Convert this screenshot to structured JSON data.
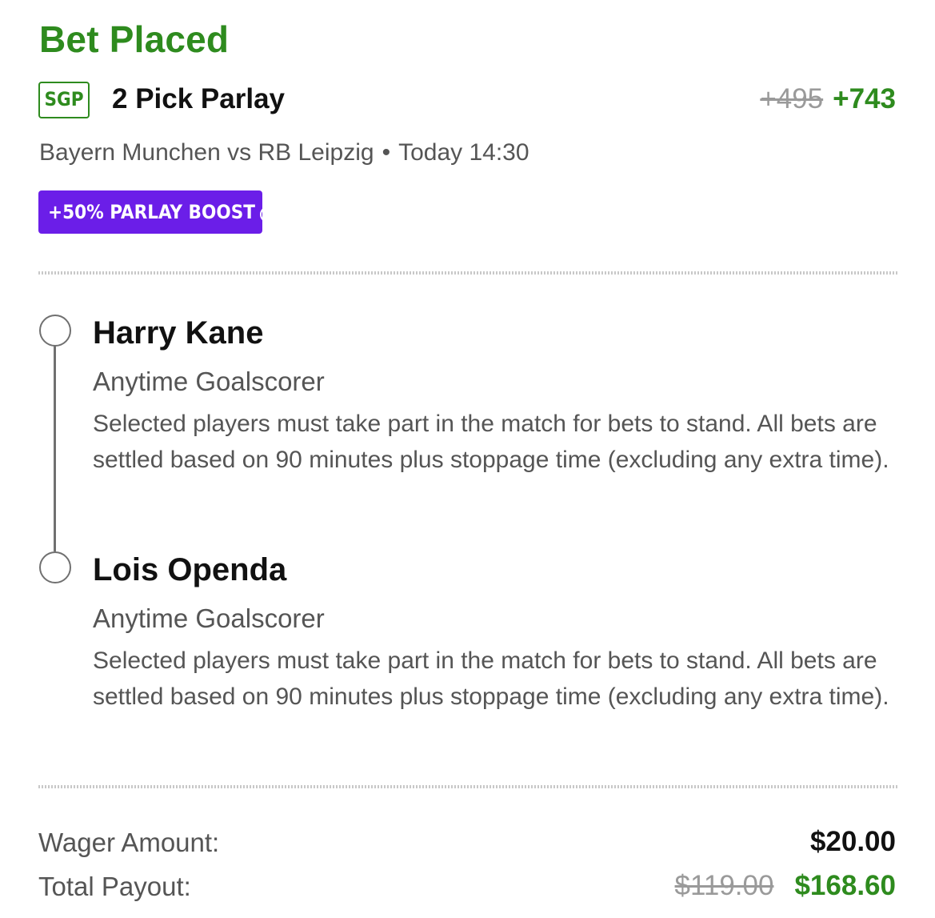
{
  "status": {
    "title": "Bet Placed"
  },
  "bet": {
    "badge": "SGP",
    "title": "2 Pick Parlay",
    "odds_original": "+495",
    "odds_boosted": "+743",
    "match": "Bayern Munchen vs RB Leipzig",
    "separator": "•",
    "time": "Today 14:30",
    "boost_label": "+50% PARLAY BOOST",
    "boost_info_icon": "i"
  },
  "legs": [
    {
      "player": "Harry Kane",
      "market": "Anytime Goalscorer",
      "rules": "Selected players must take part in the match for bets to stand. All bets are settled based on 90 minutes plus stoppage time (excluding any extra time)."
    },
    {
      "player": "Lois Openda",
      "market": "Anytime Goalscorer",
      "rules": "Selected players must take part in the match for bets to stand. All bets are settled based on 90 minutes plus stoppage time (excluding any extra time)."
    }
  ],
  "summary": {
    "wager_label": "Wager Amount:",
    "wager_value": "$20.00",
    "payout_label": "Total Payout:",
    "payout_original": "$119.00",
    "payout_boosted": "$168.60"
  },
  "colors": {
    "accent_green": "#2e8b1e",
    "boost_purple": "#6b1ee8",
    "muted_text": "#555555",
    "strike_gray": "#9a9a9a"
  }
}
